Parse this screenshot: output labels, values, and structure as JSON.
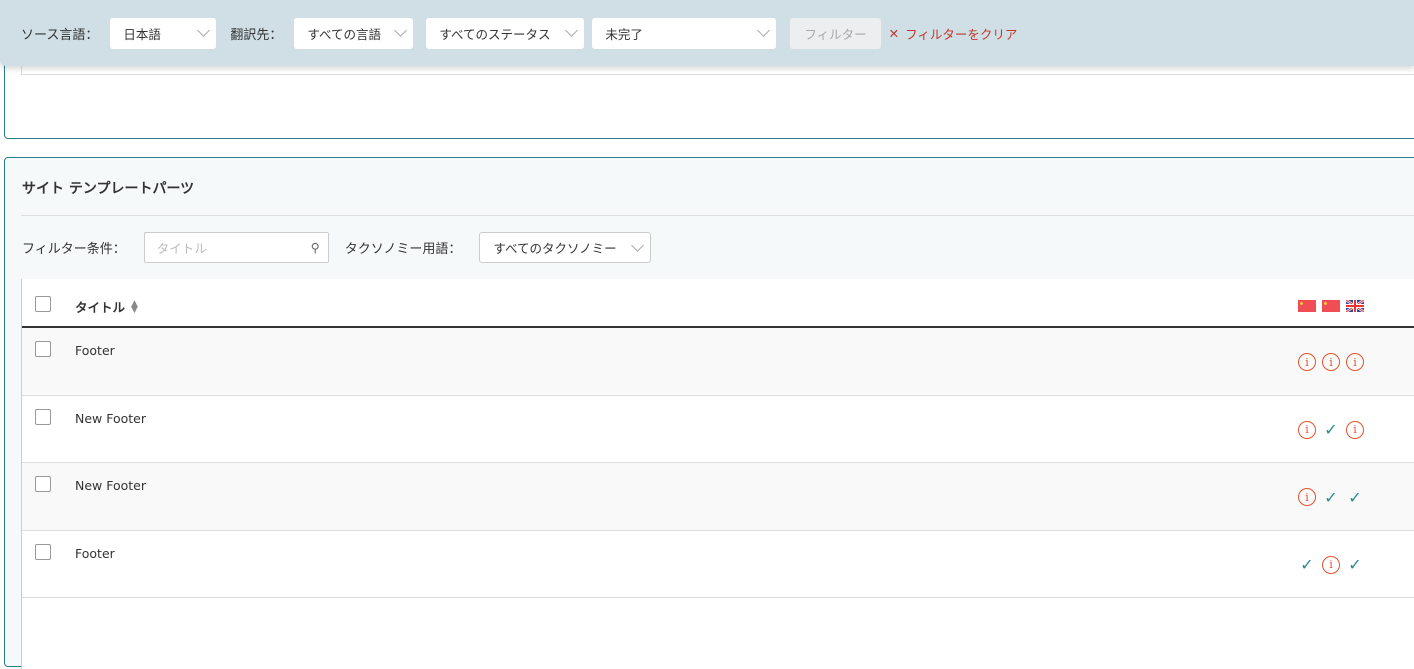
{
  "topbar": {
    "source_label": "ソース言語：",
    "source_value": "日本語",
    "target_label": "翻訳先：",
    "target_value": "すべての言語",
    "status_value": "すべてのステータス",
    "completion_value": "未完了",
    "filter_button": "フィルター",
    "clear_filter": "フィルターをクリア"
  },
  "panel": {
    "title": "サイト テンプレートパーツ",
    "filter_label": "フィルター条件：",
    "search_placeholder": "タイトル",
    "taxonomy_label": "タクソノミー用語：",
    "taxonomy_value": "すべてのタクソノミー"
  },
  "table": {
    "title_header": "タイトル",
    "languages": [
      "zh",
      "zh",
      "en"
    ],
    "rows": [
      {
        "title": "Footer",
        "status": [
          "info",
          "info",
          "info"
        ]
      },
      {
        "title": "New Footer",
        "status": [
          "info",
          "check",
          "info"
        ]
      },
      {
        "title": "New Footer",
        "status": [
          "info",
          "check",
          "check"
        ]
      },
      {
        "title": "Footer",
        "status": [
          "check",
          "info",
          "check"
        ]
      }
    ]
  },
  "colors": {
    "accent": "#2a7f8a",
    "topbar": "#cfdfe5",
    "warning": "#e0532e",
    "ok": "#2a8a8a"
  }
}
